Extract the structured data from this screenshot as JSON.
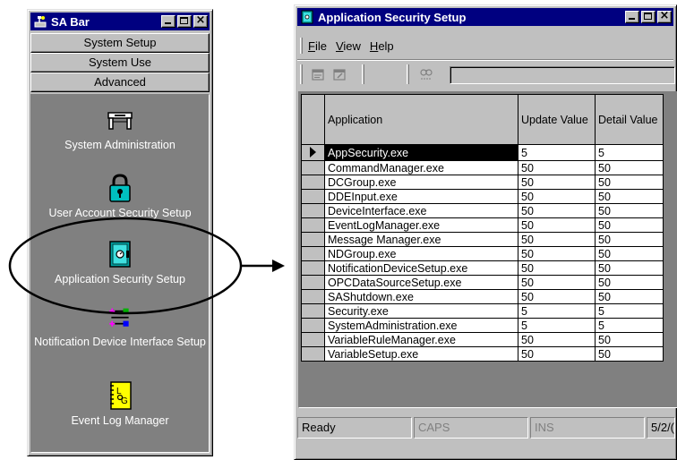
{
  "sabar": {
    "title": "SA Bar",
    "buttons": [
      "System Setup",
      "System Use",
      "Advanced"
    ],
    "tools": [
      {
        "label": "System Administration",
        "icon": "system-administration-icon"
      },
      {
        "label": "User Account Security Setup",
        "icon": "padlock-icon"
      },
      {
        "label": "Application Security Setup",
        "icon": "safe-icon"
      },
      {
        "label": "Notification Device Interface Setup",
        "icon": "notification-device-icon"
      },
      {
        "label": "Event Log Manager",
        "icon": "log-notebook-icon"
      }
    ]
  },
  "appsec": {
    "title": "Application Security Setup",
    "menu": [
      "File",
      "View",
      "Help"
    ],
    "columns": [
      "Application",
      "Update Value",
      "Detail Value"
    ],
    "rows": [
      {
        "app": "AppSecurity.exe",
        "update": "5",
        "detail": "5"
      },
      {
        "app": "CommandManager.exe",
        "update": "50",
        "detail": "50"
      },
      {
        "app": "DCGroup.exe",
        "update": "50",
        "detail": "50"
      },
      {
        "app": "DDEInput.exe",
        "update": "50",
        "detail": "50"
      },
      {
        "app": "DeviceInterface.exe",
        "update": "50",
        "detail": "50"
      },
      {
        "app": "EventLogManager.exe",
        "update": "50",
        "detail": "50"
      },
      {
        "app": "Message Manager.exe",
        "update": "50",
        "detail": "50"
      },
      {
        "app": "NDGroup.exe",
        "update": "50",
        "detail": "50"
      },
      {
        "app": "NotificationDeviceSetup.exe",
        "update": "50",
        "detail": "50"
      },
      {
        "app": "OPCDataSourceSetup.exe",
        "update": "50",
        "detail": "50"
      },
      {
        "app": "SAShutdown.exe",
        "update": "50",
        "detail": "50"
      },
      {
        "app": "Security.exe",
        "update": "5",
        "detail": "5"
      },
      {
        "app": "SystemAdministration.exe",
        "update": "5",
        "detail": "5"
      },
      {
        "app": "VariableRuleManager.exe",
        "update": "50",
        "detail": "50"
      },
      {
        "app": "VariableSetup.exe",
        "update": "50",
        "detail": "50"
      }
    ],
    "status": {
      "ready": "Ready",
      "caps": "CAPS",
      "ins": "INS",
      "date": "5/2/("
    }
  },
  "colors": {
    "titlebar": "#000080",
    "face": "#c0c0c0",
    "panel": "#808080"
  }
}
